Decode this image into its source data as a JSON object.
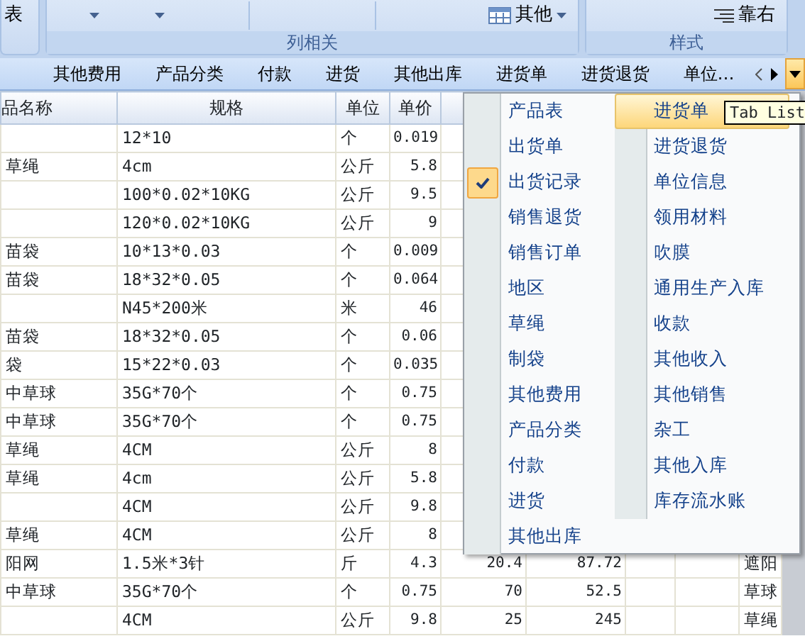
{
  "ribbon": {
    "groups": [
      {
        "items": [
          {
            "kind": "text-button",
            "label": "表"
          }
        ]
      },
      {
        "label": "列相关",
        "items": [
          {
            "kind": "dropdown"
          },
          {
            "kind": "dropdown"
          },
          {
            "kind": "separator"
          },
          {
            "kind": "separator"
          },
          {
            "kind": "table-button",
            "label": "其他"
          }
        ]
      },
      {
        "label": "样式",
        "items": [
          {
            "kind": "align-button",
            "label": "靠右"
          }
        ]
      }
    ]
  },
  "tabs": [
    {
      "label": "其他费用"
    },
    {
      "label": "产品分类"
    },
    {
      "label": "付款"
    },
    {
      "label": "进货"
    },
    {
      "label": "其他出库"
    },
    {
      "label": "进货单"
    },
    {
      "label": "进货退货"
    },
    {
      "label": "单位…"
    }
  ],
  "table": {
    "columns": [
      "品名称",
      "规格",
      "单位",
      "单价"
    ],
    "rows": [
      {
        "name": "",
        "spec": "12*10",
        "unit": "个",
        "price": "0.019"
      },
      {
        "name": "草绳",
        "spec": "4cm",
        "unit": "公斤",
        "price": "5.8"
      },
      {
        "name": "",
        "spec": "100*0.02*10KG",
        "unit": "公斤",
        "price": "9.5"
      },
      {
        "name": "",
        "spec": "120*0.02*10KG",
        "unit": "公斤",
        "price": "9"
      },
      {
        "name": "苗袋",
        "spec": "10*13*0.03",
        "unit": "个",
        "price": "0.009"
      },
      {
        "name": "苗袋",
        "spec": "18*32*0.05",
        "unit": "个",
        "price": "0.064"
      },
      {
        "name": "",
        "spec": "N45*200米",
        "unit": "米",
        "price": "46"
      },
      {
        "name": "苗袋",
        "spec": "18*32*0.05",
        "unit": "个",
        "price": "0.06"
      },
      {
        "name": "袋",
        "spec": "15*22*0.03",
        "unit": "个",
        "price": "0.035"
      },
      {
        "name": "中草球",
        "spec": "35G*70个",
        "unit": "个",
        "price": "0.75"
      },
      {
        "name": "中草球",
        "spec": "35G*70个",
        "unit": "个",
        "price": "0.75"
      },
      {
        "name": "草绳",
        "spec": "4CM",
        "unit": "公斤",
        "price": "8"
      },
      {
        "name": "草绳",
        "spec": "4cm",
        "unit": "公斤",
        "price": "5.8"
      },
      {
        "name": "",
        "spec": "4CM",
        "unit": "公斤",
        "price": "9.8"
      },
      {
        "name": "草绳",
        "spec": "4CM",
        "unit": "公斤",
        "price": "8"
      },
      {
        "name": "阳网",
        "spec": "1.5米*3针",
        "unit": "斤",
        "price": "4.3",
        "column_5": "20.4",
        "column_6": "87.72",
        "column_9": "遮阳"
      },
      {
        "name": "中草球",
        "spec": "35G*70个",
        "unit": "个",
        "price": "0.75",
        "column_5": "70",
        "column_6": "52.5",
        "column_9": "草球"
      },
      {
        "name": "",
        "spec": "4CM",
        "unit": "公斤",
        "price": "9.8",
        "column_5": "25",
        "column_6": "245",
        "column_9": "草绳"
      }
    ]
  },
  "tab_list_menu": {
    "tooltip": "Tab List",
    "columns": [
      [
        {
          "label": "产品表",
          "checked": false,
          "selected": false
        },
        {
          "label": "出货单",
          "checked": false,
          "selected": false
        },
        {
          "label": "出货记录",
          "checked": true,
          "selected": false
        },
        {
          "label": "销售退货",
          "checked": false,
          "selected": false
        },
        {
          "label": "销售订单",
          "checked": false,
          "selected": false
        },
        {
          "label": "地区",
          "checked": false,
          "selected": false
        },
        {
          "label": "草绳",
          "checked": false,
          "selected": false
        },
        {
          "label": "制袋",
          "checked": false,
          "selected": false
        },
        {
          "label": "其他费用",
          "checked": false,
          "selected": false
        },
        {
          "label": "产品分类",
          "checked": false,
          "selected": false
        },
        {
          "label": "付款",
          "checked": false,
          "selected": false
        },
        {
          "label": "进货",
          "checked": false,
          "selected": false
        },
        {
          "label": "其他出库",
          "checked": false,
          "selected": false
        }
      ],
      [
        {
          "label": "进货单",
          "checked": false,
          "selected": true
        },
        {
          "label": "进货退货",
          "checked": false,
          "selected": false
        },
        {
          "label": "单位信息",
          "checked": false,
          "selected": false
        },
        {
          "label": "领用材料",
          "checked": false,
          "selected": false
        },
        {
          "label": "吹膜",
          "checked": false,
          "selected": false
        },
        {
          "label": "通用生产入库",
          "checked": false,
          "selected": false
        },
        {
          "label": "收款",
          "checked": false,
          "selected": false
        },
        {
          "label": "其他收入",
          "checked": false,
          "selected": false
        },
        {
          "label": "其他销售",
          "checked": false,
          "selected": false
        },
        {
          "label": "杂工",
          "checked": false,
          "selected": false
        },
        {
          "label": "其他入库",
          "checked": false,
          "selected": false
        },
        {
          "label": "库存流水账",
          "checked": false,
          "selected": false
        }
      ]
    ]
  }
}
